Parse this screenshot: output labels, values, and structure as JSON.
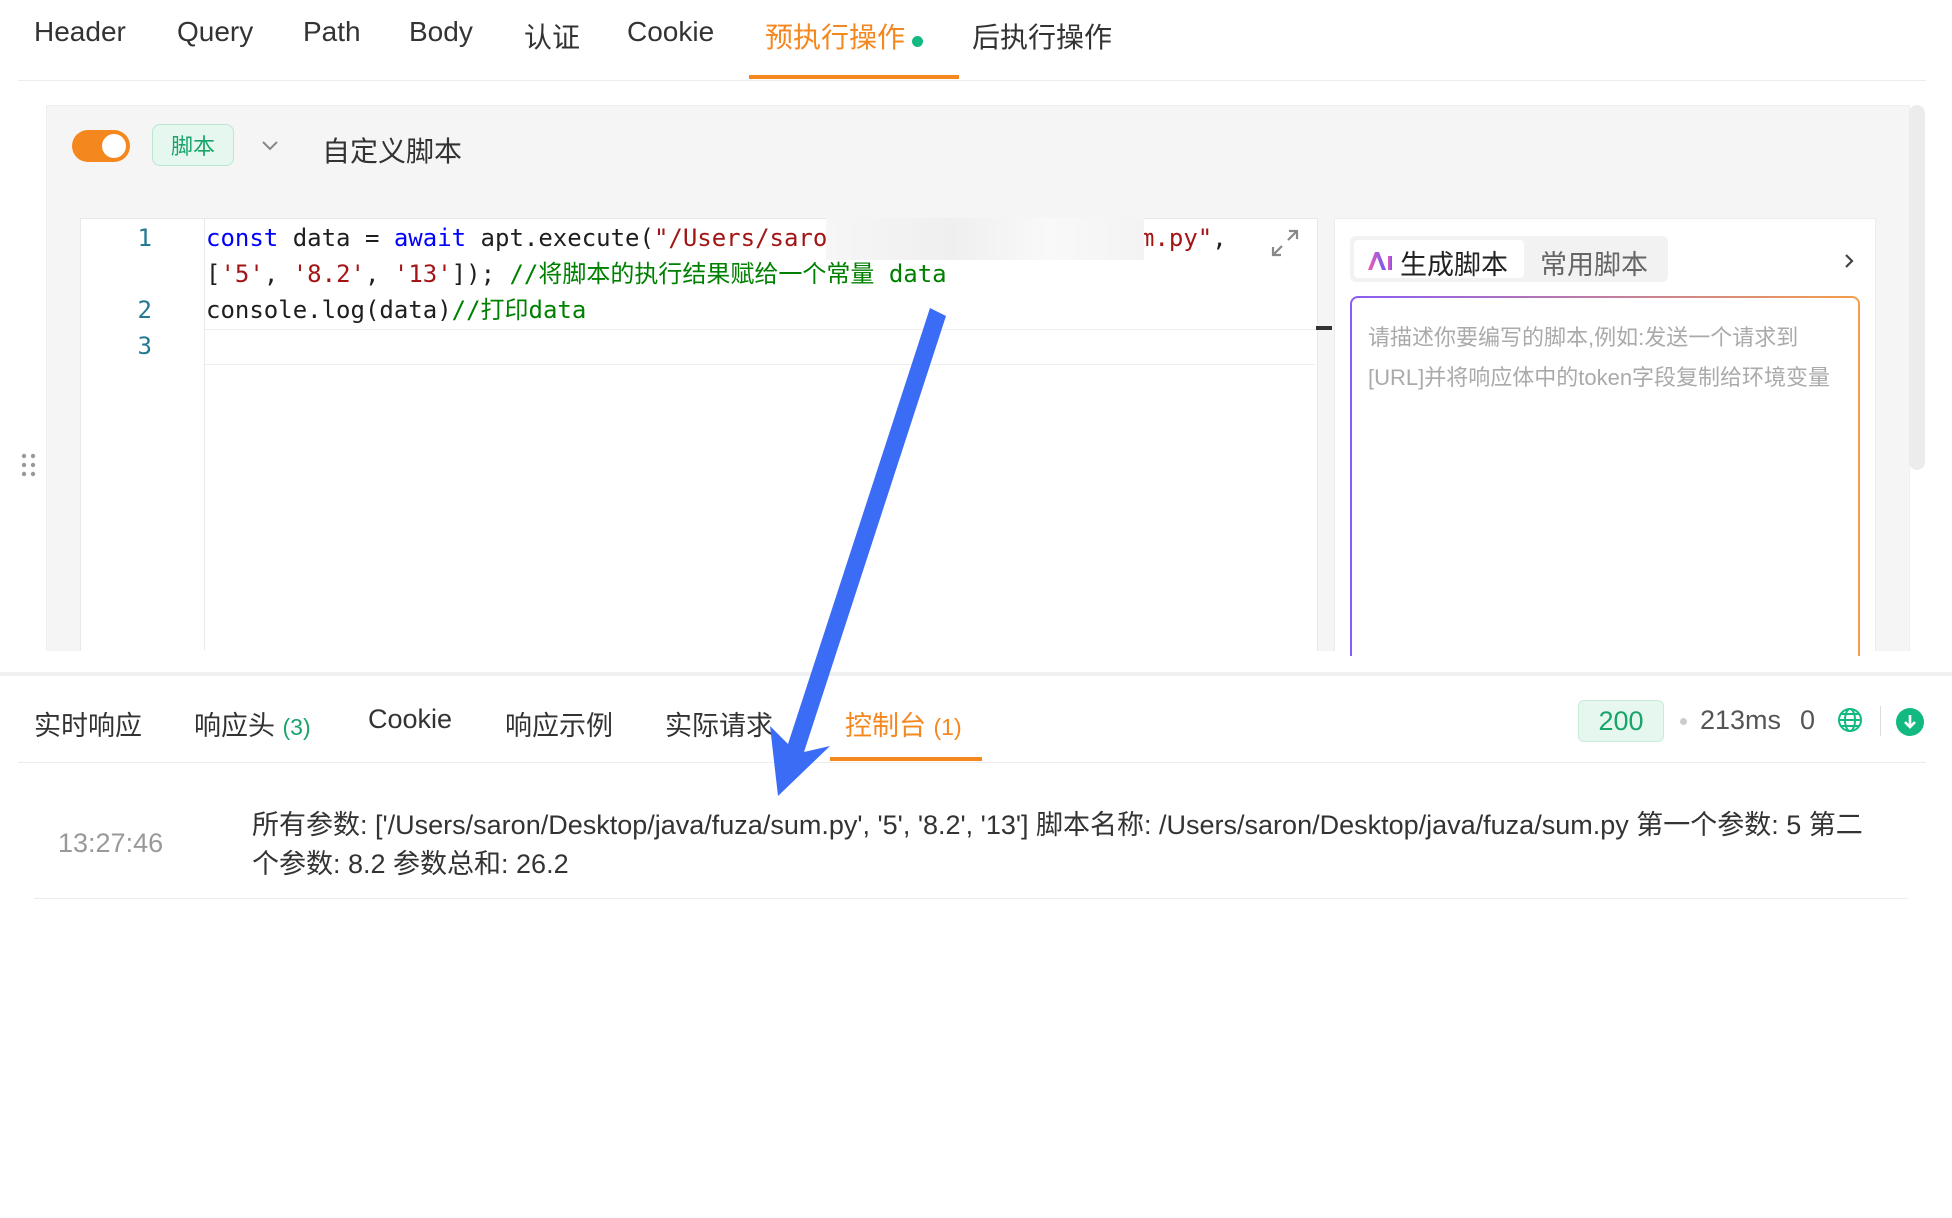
{
  "top_tabs": [
    "Header",
    "Query",
    "Path",
    "Body",
    "认证",
    "Cookie",
    "预执行操作",
    "后执行操作"
  ],
  "script": {
    "tag": "脚本",
    "title": "自定义脚本"
  },
  "editor": {
    "line_numbers": [
      "1",
      "2",
      "3"
    ],
    "line1a": {
      "kw1": "const",
      "t1": " data = ",
      "kw2": "await",
      "t2": " apt.execute(",
      "s1": "\"/Users/saro",
      "s2": "m.py\"",
      "t3": ","
    },
    "line1b": {
      "t1": "[",
      "s1": "'5'",
      "t2": ", ",
      "s2": "'8.2'",
      "t3": ", ",
      "s3": "'13'",
      "t4": "]); ",
      "c1": "//将脚本的执行结果赋给一个常量 data"
    },
    "line2": {
      "t1": "console.log(data)",
      "c1": "//打印data"
    }
  },
  "ai": {
    "tab_generate": "生成脚本",
    "tab_common": "常用脚本",
    "placeholder": "请描述你要编写的脚本,例如:发送一个请求到[URL]并将响应体中的token字段复制给环境变量"
  },
  "response_tabs": {
    "realtime": "实时响应",
    "headers": "响应头",
    "headers_count": "(3)",
    "cookie": "Cookie",
    "example": "响应示例",
    "actual": "实际请求",
    "console": "控制台",
    "console_count": "(1)"
  },
  "response_status": {
    "code": "200",
    "time": "213ms",
    "size": "0"
  },
  "console_log": {
    "time": "13:27:46",
    "text": "所有参数: ['/Users/saron/Desktop/java/fuza/sum.py', '5', '8.2', '13'] 脚本名称: /Users/saron/Desktop/java/fuza/sum.py 第一个参数: 5 第二个参数: 8.2 参数总和: 26.2"
  },
  "colors": {
    "accent": "#f5871f",
    "success": "#12b981",
    "annotation_arrow": "#3b6cf5"
  }
}
